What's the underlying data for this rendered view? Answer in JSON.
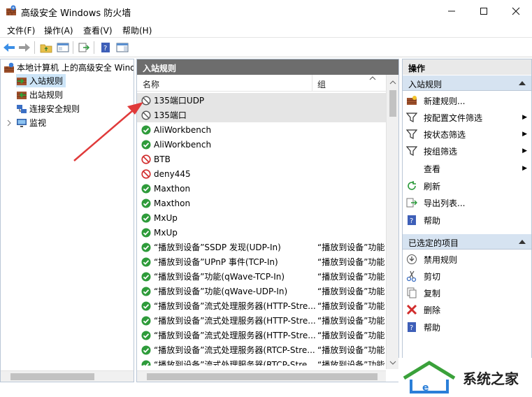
{
  "window": {
    "title": "高级安全 Windows 防火墙"
  },
  "menu": [
    "文件(F)",
    "操作(A)",
    "查看(V)",
    "帮助(H)"
  ],
  "tree": {
    "root": "本地计算机 上的高级安全 Windows",
    "items": [
      "入站规则",
      "出站规则",
      "连接安全规则",
      "监视"
    ]
  },
  "middle": {
    "header": "入站规则",
    "col_name": "名称",
    "col_group": "组",
    "rows": [
      {
        "name": "135端口UDP",
        "group": "",
        "status": "disabled",
        "selected": true
      },
      {
        "name": "135端口",
        "group": "",
        "status": "disabled",
        "selected": true
      },
      {
        "name": "AliWorkbench",
        "group": "",
        "status": "allow"
      },
      {
        "name": "AliWorkbench",
        "group": "",
        "status": "allow"
      },
      {
        "name": "BTB",
        "group": "",
        "status": "block"
      },
      {
        "name": "deny445",
        "group": "",
        "status": "block"
      },
      {
        "name": "Maxthon",
        "group": "",
        "status": "allow"
      },
      {
        "name": "Maxthon",
        "group": "",
        "status": "allow"
      },
      {
        "name": "MxUp",
        "group": "",
        "status": "allow"
      },
      {
        "name": "MxUp",
        "group": "",
        "status": "allow"
      },
      {
        "name": "“播放到设备”SSDP 发现(UDP-In)",
        "group": "“播放到设备”功能",
        "status": "allow"
      },
      {
        "name": "“播放到设备”UPnP 事件(TCP-In)",
        "group": "“播放到设备”功能",
        "status": "allow"
      },
      {
        "name": "“播放到设备”功能(qWave-TCP-In)",
        "group": "“播放到设备”功能",
        "status": "allow"
      },
      {
        "name": "“播放到设备”功能(qWave-UDP-In)",
        "group": "“播放到设备”功能",
        "status": "allow"
      },
      {
        "name": "“播放到设备”流式处理服务器(HTTP-Stre...",
        "group": "“播放到设备”功能",
        "status": "allow"
      },
      {
        "name": "“播放到设备”流式处理服务器(HTTP-Stre...",
        "group": "“播放到设备”功能",
        "status": "allow"
      },
      {
        "name": "“播放到设备”流式处理服务器(HTTP-Stre...",
        "group": "“播放到设备”功能",
        "status": "allow"
      },
      {
        "name": "“播放到设备”流式处理服务器(RTCP-Stre...",
        "group": "“播放到设备”功能",
        "status": "allow"
      },
      {
        "name": "“播放到设备”流式处理服务器(RTCP-Stre...",
        "group": "“播放到设备”功能",
        "status": "allow"
      }
    ]
  },
  "actions": {
    "header": "操作",
    "section1": "入站规则",
    "items1": [
      "新建规则...",
      "按配置文件筛选",
      "按状态筛选",
      "按组筛选",
      "查看",
      "刷新",
      "导出列表...",
      "帮助"
    ],
    "section2": "已选定的项目",
    "items2": [
      "禁用规则",
      "剪切",
      "复制",
      "删除",
      "帮助"
    ]
  },
  "watermark": {
    "text": "系统之家"
  },
  "colors": {
    "allow": "#2e9b3a",
    "block": "#d12c2c",
    "disabled": "#555555",
    "arrow": "#e03a3a"
  }
}
